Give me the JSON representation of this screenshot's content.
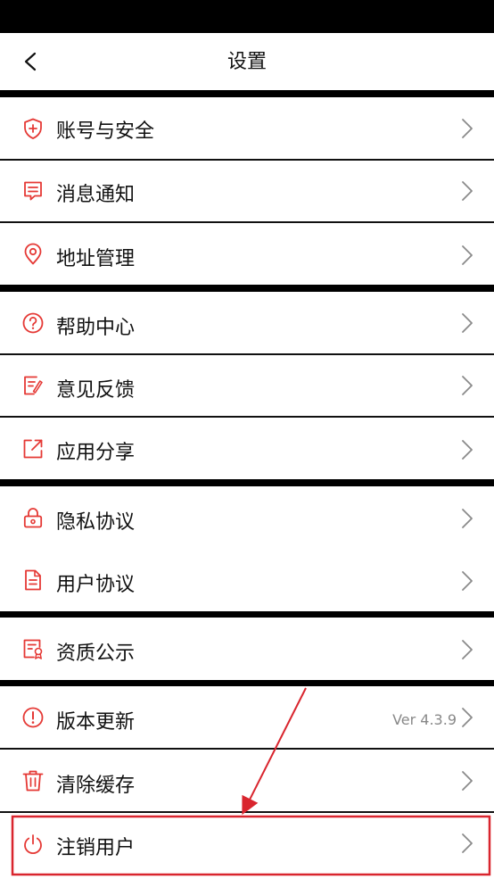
{
  "header": {
    "title": "设置",
    "back_icon": "chevron-left-icon"
  },
  "items": [
    {
      "key": "account",
      "label": "账号与安全",
      "icon": "shield-plus-icon"
    },
    {
      "key": "messages",
      "label": "消息通知",
      "icon": "message-icon"
    },
    {
      "key": "address",
      "label": "地址管理",
      "icon": "location-pin-icon"
    },
    {
      "key": "help",
      "label": "帮助中心",
      "icon": "question-icon"
    },
    {
      "key": "feedback",
      "label": "意见反馈",
      "icon": "edit-note-icon"
    },
    {
      "key": "share",
      "label": "应用分享",
      "icon": "share-icon"
    },
    {
      "key": "privacy",
      "label": "隐私协议",
      "icon": "lock-icon"
    },
    {
      "key": "user-agreement",
      "label": "用户协议",
      "icon": "document-icon"
    },
    {
      "key": "qualification",
      "label": "资质公示",
      "icon": "certificate-icon"
    },
    {
      "key": "version",
      "label": "版本更新",
      "icon": "alert-icon",
      "value": "Ver 4.3.9"
    },
    {
      "key": "cache",
      "label": "清除缓存",
      "icon": "trash-icon"
    },
    {
      "key": "deactivate",
      "label": "注销用户",
      "icon": "power-icon"
    }
  ],
  "colors": {
    "accent": "#e53935",
    "annotation": "#d9252e",
    "divider": "#111111",
    "text": "#111111",
    "secondary_text": "#888888",
    "chevron": "#8a8a8a"
  }
}
